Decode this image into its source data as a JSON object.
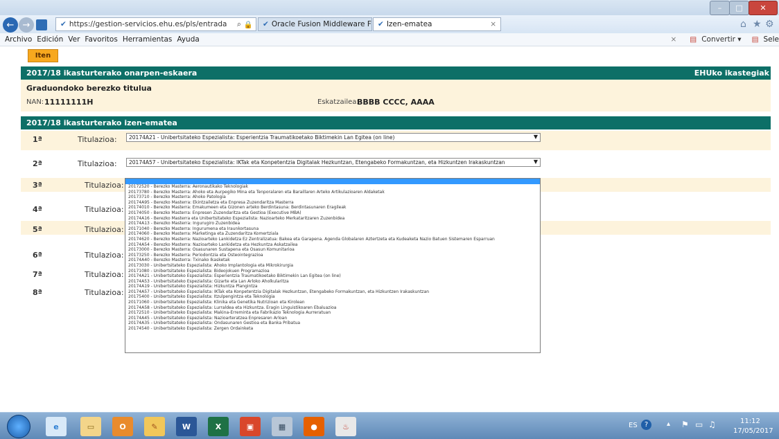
{
  "browser": {
    "address": "https://gestion-servicios.ehu.es/pls/entrada",
    "tabs": [
      "Oracle Fusion Middleware For...",
      "Izen-ematea"
    ],
    "menu": [
      "Archivo",
      "Edición",
      "Ver",
      "Favoritos",
      "Herramientas",
      "Ayuda"
    ],
    "right_tools": {
      "convert": "Convertir",
      "select": "Sele"
    }
  },
  "page": {
    "iten_button": "Iten",
    "header1": {
      "title": "2017/18 ikasturterako onarpen-eskaera",
      "right_link": "EHUko ikastegiak"
    },
    "info": {
      "titulu_type": "Graduondoko berezko titulua",
      "nan_label": "NAN:",
      "nan_value": "11111111H",
      "eskatzaile_label": "Eskatzailea:",
      "eskatzaile_value": "BBBB CCCC, AAAA"
    },
    "header2": {
      "title": "2017/18 ikasturterako izen-ematea"
    },
    "rows": [
      {
        "num": "1ª",
        "label": "Titulazioa:",
        "value": "20174A21 - Unibertsitateko Espezialista: Esperientzia Traumatikoetako Biktimekin Lan Egitea (on line)"
      },
      {
        "num": "2ª",
        "label": "Titulazioa:",
        "value": "20174A57 - Unibertsitateko Espezialista: IKTak eta Konpetentzia Digitalak Hezkuntzan, Etengabeko Formakuntzan, eta Hizkuntzen Irakaskuntzan"
      },
      {
        "num": "3ª",
        "label": "Titulazioa:",
        "value": ""
      },
      {
        "num": "4ª",
        "label": "Titulazioa:",
        "value": ""
      },
      {
        "num": "5ª",
        "label": "Titulazioa:",
        "value": ""
      },
      {
        "num": "6ª",
        "label": "Titulazioa:",
        "value": ""
      },
      {
        "num": "7ª",
        "label": "Titulazioa:",
        "value": ""
      },
      {
        "num": "8ª",
        "label": "Titulazioa:",
        "value": ""
      }
    ],
    "dropdown_options": [
      "20172520 - Berezko Masterra: Aeronautikako Teknologiak",
      "20173780 - Berezko Masterra: Ahoko eta Aurpegiko Mina eta Tenporalaren eta Baraillaren Arteko Artikulazioaren Aldaketak",
      "20173710 - Berezko Masterra: Ahoko Patologia",
      "20174A95 - Berezko Masterra: Ekintzailetza eta Enpresa Zuzendaritza Masterra",
      "20174010 - Berezko Masterra: Emakumeen eta Gizonen arteko Berdintasuna: Berdintasunaren Eragileak",
      "20174050 - Berezko Masterra: Enpresen Zuzendaritza eta Gestioa (Executive MBA)",
      "20174A16 - Berezko Masterra eta Unibertsitateko Espezialista: Nazioarteko Merkataritzaren Zuzenbidea",
      "20174A13 - Berezko Masterra: Ingurugiro Zuzenbidea",
      "20171040 - Berezko Masterra: Ingurumena eta Iraunkortasuna",
      "20174060 - Berezko Masterra: Marketinga eta Zuzendaritza Komertziala",
      "20174620 - Berezko Masterra: Nazioarteko Lankidetza Ez Zentralizatua: Bakea eta Garapena. Agenda Globalaren Aztertzeta eta Kudeaketa Nazio Batuen Sistemaren Esparruan",
      "20174A54 - Berezko Masterra: Nazioarteko Lankidetza eta Hezkuntza Askatzailea",
      "20173000 - Berezko Masterra: Osasunaren Sustapena eta Osasun Komunitarioa",
      "20173250 - Berezko Masterra: Periodontzia eta Osteointegrazioa",
      "20174A40 - Berezko Masterra: Txinako Ikasketak",
      "20173030 - Unibertsitateko Espezialista: Ahoko Implantologia eta Mikrokirurgia",
      "20171080 - Unibertsitateko Espezialista: Bideojokuen Programazioa",
      "20174A21 - Unibertsitateko Espezialista: Esperientzia Traumatikoetako Biktimekin Lan Egitea (on line)",
      "20174A53 - Unibertsitateko Espezialista: Gizarte eta Lan Arloko Aholkularitza",
      "20174A19 - Unibertsitateko Espezialista: Hizkuntza Plangintza",
      "20174A57 - Unibertsitateko Espezialista: IKTak eta Konpetentzia Digitalak Hezkuntzan, Etengabeko Formakuntzan, eta Hizkuntzen Irakaskuntzan",
      "20175400 - Unibertsitateko Espezialista: Itzulpengintza eta Teknologia",
      "20171060 - Unibertsitateko Espezialista: Klinika eta Genetika Nutrizioan eta Kirolean",
      "20174A58 - Unibertsitateko Espezialista: Lurraldea eta Hizkuntza. Eragin Linguistikoaren Ebaluazioa",
      "20172510 - Unibertsitateko Espezialista: Makina-Erreminta eta Fabrikazio Teknologia Aurreratuan",
      "20174A45 - Unibertsitateko Espezialista: Nazioarteratzea Enpresaren Arloan",
      "20174A35 - Unibertsitateko Espezialista: Ondasunaren Gestioa eta Banka Pribatua",
      "20174540 - Unibertsitateko Espezialista: Zergen Ordainketa"
    ]
  },
  "taskbar": {
    "language": "ES",
    "time": "11:12",
    "date": "17/05/2017"
  },
  "colors": {
    "band": "#0d6f67",
    "cream": "#fdf3dc",
    "accent": "#f7a81e",
    "highlight": "#3399ff"
  }
}
